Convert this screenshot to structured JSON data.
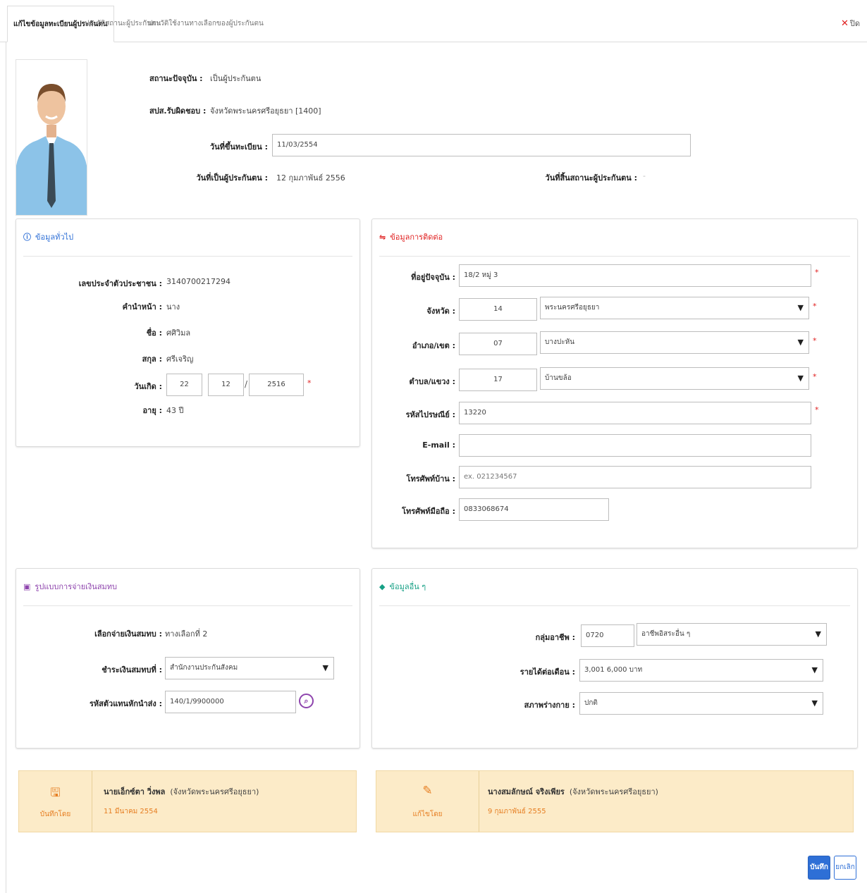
{
  "tabs": [
    {
      "label": "แก้ไขข้อมูลทะเบียนผู้ประกันตน",
      "active": true
    },
    {
      "label": "ประวัติสถานะผู้ประกันตน",
      "active": false
    },
    {
      "label": "ประวัติใช้งานทางเลือกของผู้ประกันตน",
      "active": false
    }
  ],
  "close": {
    "icon": "close-icon",
    "label": "ปิด"
  },
  "header": {
    "status_label": "สถานะปัจจุบัน :",
    "status_value": "เป็นผู้ประกันตน",
    "office_label": "สปส.รับผิดชอบ :",
    "office_value": "จังหวัดพระนครศรีอยุธยา [1400]",
    "register_date_label": "วันที่ขึ้นทะเบียน :",
    "register_date_value": "11/03/2554",
    "insured_date_label": "วันที่เป็นผู้ประกันตน :",
    "insured_date_value": "12 กุมภาพันธ์ 2556",
    "end_date_label": "วันที่สิ้นสถานะผู้ประกันตน :",
    "end_date_value": "-"
  },
  "general": {
    "title": "ข้อมูลทั่วไป",
    "icon": "info-icon",
    "id_label": "เลขประจำตัวประชาชน :",
    "id_value": "3140700217294",
    "prefix_label": "คำนำหน้า :",
    "prefix_value": "นาง",
    "name_label": "ชื่อ :",
    "name_value": "ศศิวิมล",
    "surname_label": "สกุล :",
    "surname_value": "ศรีเจริญ",
    "birth_label": "วันเกิด :",
    "birth_day": "22",
    "birth_month": "12",
    "birth_year": "2516",
    "age_label": "อายุ :",
    "age_value": "43 ปี",
    "required_mark": "*",
    "slash": "/"
  },
  "contact": {
    "title": "ข้อมูลการติดต่อ",
    "icon": "signpost-icon",
    "address_label": "ที่อยู่ปัจจุบัน :",
    "address_value": "18/2 หมู่ 3",
    "province_label": "จังหวัด :",
    "province_code": "14",
    "province_value": "พระนครศรีอยุธยา",
    "district_label": "อำเภอ/เขต :",
    "district_code": "07",
    "district_value": "บางปะหัน",
    "subdistrict_label": "ตำบล/แขวง :",
    "subdistrict_code": "17",
    "subdistrict_value": "บ้านขล้อ",
    "postcode_label": "รหัสไปรษณีย์ :",
    "postcode_value": "13220",
    "email_label": "E-mail :",
    "email_value": "",
    "phone_label": "โทรศัพท์บ้าน :",
    "phone_placeholder": "ex. 021234567",
    "mobile_label": "โทรศัพท์มือถือ :",
    "mobile_value": "0833068674",
    "required_mark": "*"
  },
  "payment": {
    "title": "รูปแบบการจ่ายเงินสมทบ",
    "icon": "money-icon",
    "option_label": "เลือกจ่ายเงินสมทบ :",
    "option_value": "ทางเลือกที่ 2",
    "place_label": "ชำระเงินสมทบที่ :",
    "place_value": "สำนักงานประกันสังคม",
    "agent_label": "รหัสตัวแทนหักนำส่ง :",
    "agent_value": "140/1/9900000"
  },
  "other": {
    "title": "ข้อมูลอื่น ๆ",
    "icon": "tag-icon",
    "career_label": "กลุ่มอาชีพ :",
    "career_code": "0720",
    "career_value": "อาชีพอิสระอื่น ๆ",
    "income_label": "รายได้ต่อเดือน :",
    "income_value": "3,001 6,000 บาท",
    "health_label": "สภาพร่างกาย :",
    "health_value": "ปกติ"
  },
  "audit": {
    "saved_caption": "บันทึกโดย",
    "saved_icon": "save-icon",
    "saved_by": "นายเอ็กซ์ตา วิ่งพล",
    "saved_office": "(จังหวัดพระนครศรีอยุธยา)",
    "saved_date": "11 มีนาคม 2554",
    "edited_caption": "แก้ไขโดย",
    "edited_icon": "edit-icon",
    "edited_by": "นางสมลักษณ์ จริงเพียร",
    "edited_office": "(จังหวัดพระนครศรีอยุธยา)",
    "edited_date": "9 กุมภาพันธ์ 2555"
  },
  "actions": {
    "save": "บันทึก",
    "cancel": "ยกเลิก"
  },
  "colors": {
    "accent": "#2e6fd6",
    "required": "#e02020",
    "info_bg": "#fcebc8",
    "contact_icon": "#e02020",
    "payment_icon": "#8e44ad",
    "other_icon": "#16a085",
    "general_icon": "#2e6fd6"
  }
}
